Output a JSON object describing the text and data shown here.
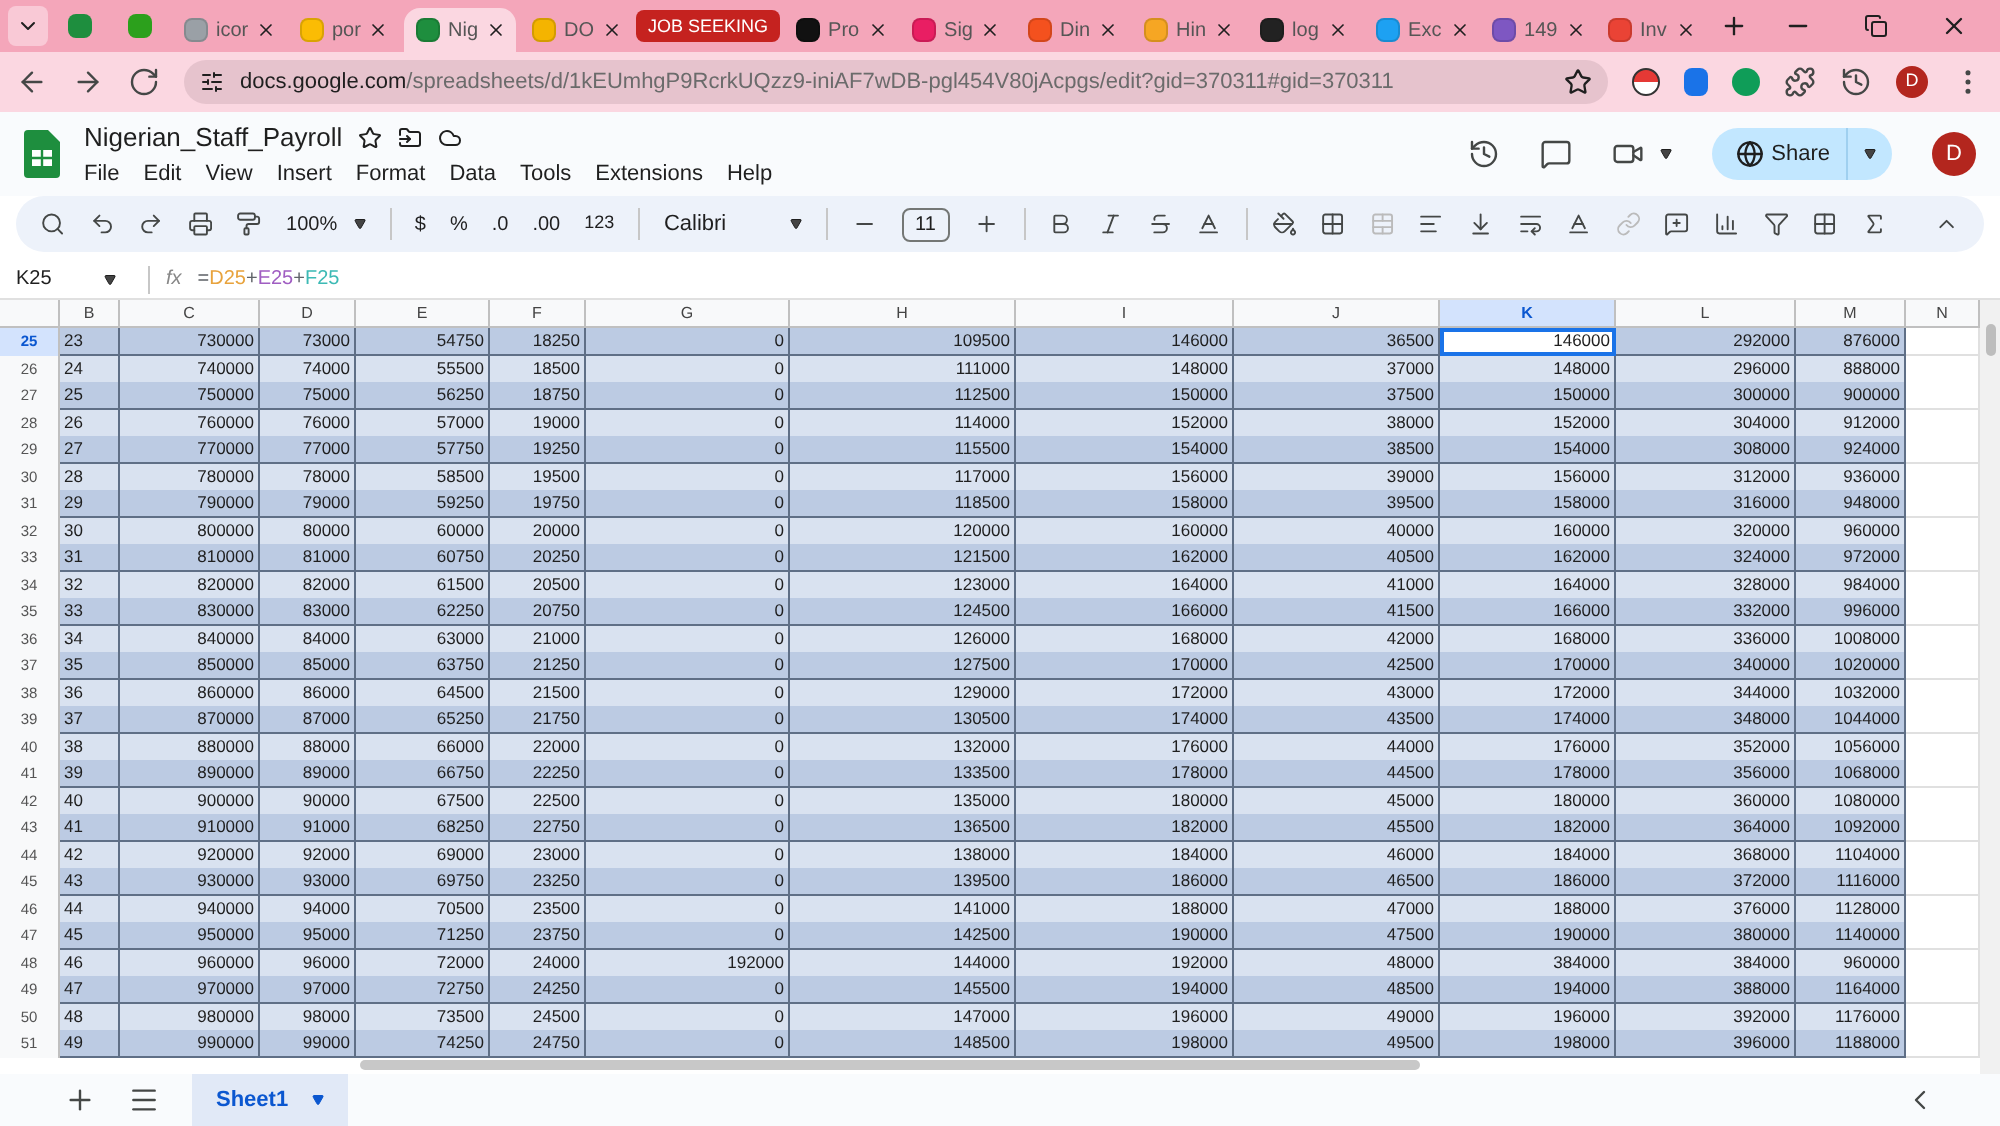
{
  "browser": {
    "tabs": [
      {
        "kind": "pinned",
        "selected": false
      },
      {
        "kind": "pinned",
        "selected": false
      },
      {
        "kind": "tab",
        "title": "icor",
        "selected": false
      },
      {
        "kind": "tab",
        "title": "por",
        "selected": false
      },
      {
        "kind": "tab",
        "title": "Nig",
        "selected": true
      },
      {
        "kind": "tab",
        "title": "DO",
        "selected": false
      },
      {
        "kind": "group",
        "title": "JOB SEEKING",
        "selected": false
      },
      {
        "kind": "tab",
        "title": "Pro",
        "selected": false
      },
      {
        "kind": "tab",
        "title": "Sig",
        "selected": false
      },
      {
        "kind": "tab",
        "title": "Din",
        "selected": false
      },
      {
        "kind": "tab",
        "title": "Hin",
        "selected": false
      },
      {
        "kind": "tab",
        "title": "log",
        "selected": false
      },
      {
        "kind": "tab",
        "title": "Exc",
        "selected": false
      },
      {
        "kind": "tab",
        "title": "149",
        "selected": false
      },
      {
        "kind": "tab",
        "title": "Inv",
        "selected": false
      }
    ],
    "url_host": "docs.google.com",
    "url_path": "/spreadsheets/d/1kEUmhgP9RcrkUQzz9-iniAF7wDB-pgl454V80jAcpgs/edit?gid=370311#gid=370311",
    "profile": "D"
  },
  "doc": {
    "title": "Nigerian_Staff_Payroll",
    "menu": [
      "File",
      "Edit",
      "View",
      "Insert",
      "Format",
      "Data",
      "Tools",
      "Extensions",
      "Help"
    ],
    "share": "Share",
    "avatar": "D"
  },
  "toolbar": {
    "zoom": "100%",
    "currency": "$",
    "percent": "%",
    "decrease_decimals": ".0",
    "increase_decimals": ".00",
    "number_format": "123",
    "font": "Calibri",
    "font_size": "11"
  },
  "formula_bar": {
    "cell": "K25",
    "fx": "fx",
    "formula": [
      {
        "kind": "operator",
        "text": "="
      },
      {
        "kind": "reference",
        "text": "D25",
        "color": "#e8a33d"
      },
      {
        "kind": "operator",
        "text": "+"
      },
      {
        "kind": "reference",
        "text": "E25",
        "color": "#a05ec2"
      },
      {
        "kind": "operator",
        "text": "+"
      },
      {
        "kind": "reference",
        "text": "F25",
        "color": "#3dbab5"
      }
    ]
  },
  "columns": [
    {
      "label": "B",
      "selected": false
    },
    {
      "label": "C",
      "selected": false
    },
    {
      "label": "D",
      "selected": false
    },
    {
      "label": "E",
      "selected": false
    },
    {
      "label": "F",
      "selected": false
    },
    {
      "label": "G",
      "selected": false
    },
    {
      "label": "H",
      "selected": false
    },
    {
      "label": "I",
      "selected": false
    },
    {
      "label": "J",
      "selected": false
    },
    {
      "label": "K",
      "selected": true
    },
    {
      "label": "L",
      "selected": false
    },
    {
      "label": "M",
      "selected": false
    },
    {
      "label": "N",
      "selected": false
    }
  ],
  "rows": [
    {
      "number": "25",
      "selected": true,
      "cells": [
        "23",
        "730000",
        "73000",
        "54750",
        "18250",
        "0",
        "109500",
        "146000",
        "36500",
        "146000",
        "292000",
        "876000"
      ]
    },
    {
      "number": "26",
      "selected": false,
      "cells": [
        "24",
        "740000",
        "74000",
        "55500",
        "18500",
        "0",
        "111000",
        "148000",
        "37000",
        "148000",
        "296000",
        "888000"
      ]
    },
    {
      "number": "27",
      "selected": false,
      "cells": [
        "25",
        "750000",
        "75000",
        "56250",
        "18750",
        "0",
        "112500",
        "150000",
        "37500",
        "150000",
        "300000",
        "900000"
      ]
    },
    {
      "number": "28",
      "selected": false,
      "cells": [
        "26",
        "760000",
        "76000",
        "57000",
        "19000",
        "0",
        "114000",
        "152000",
        "38000",
        "152000",
        "304000",
        "912000"
      ]
    },
    {
      "number": "29",
      "selected": false,
      "cells": [
        "27",
        "770000",
        "77000",
        "57750",
        "19250",
        "0",
        "115500",
        "154000",
        "38500",
        "154000",
        "308000",
        "924000"
      ]
    },
    {
      "number": "30",
      "selected": false,
      "cells": [
        "28",
        "780000",
        "78000",
        "58500",
        "19500",
        "0",
        "117000",
        "156000",
        "39000",
        "156000",
        "312000",
        "936000"
      ]
    },
    {
      "number": "31",
      "selected": false,
      "cells": [
        "29",
        "790000",
        "79000",
        "59250",
        "19750",
        "0",
        "118500",
        "158000",
        "39500",
        "158000",
        "316000",
        "948000"
      ]
    },
    {
      "number": "32",
      "selected": false,
      "cells": [
        "30",
        "800000",
        "80000",
        "60000",
        "20000",
        "0",
        "120000",
        "160000",
        "40000",
        "160000",
        "320000",
        "960000"
      ]
    },
    {
      "number": "33",
      "selected": false,
      "cells": [
        "31",
        "810000",
        "81000",
        "60750",
        "20250",
        "0",
        "121500",
        "162000",
        "40500",
        "162000",
        "324000",
        "972000"
      ]
    },
    {
      "number": "34",
      "selected": false,
      "cells": [
        "32",
        "820000",
        "82000",
        "61500",
        "20500",
        "0",
        "123000",
        "164000",
        "41000",
        "164000",
        "328000",
        "984000"
      ]
    },
    {
      "number": "35",
      "selected": false,
      "cells": [
        "33",
        "830000",
        "83000",
        "62250",
        "20750",
        "0",
        "124500",
        "166000",
        "41500",
        "166000",
        "332000",
        "996000"
      ]
    },
    {
      "number": "36",
      "selected": false,
      "cells": [
        "34",
        "840000",
        "84000",
        "63000",
        "21000",
        "0",
        "126000",
        "168000",
        "42000",
        "168000",
        "336000",
        "1008000"
      ]
    },
    {
      "number": "37",
      "selected": false,
      "cells": [
        "35",
        "850000",
        "85000",
        "63750",
        "21250",
        "0",
        "127500",
        "170000",
        "42500",
        "170000",
        "340000",
        "1020000"
      ]
    },
    {
      "number": "38",
      "selected": false,
      "cells": [
        "36",
        "860000",
        "86000",
        "64500",
        "21500",
        "0",
        "129000",
        "172000",
        "43000",
        "172000",
        "344000",
        "1032000"
      ]
    },
    {
      "number": "39",
      "selected": false,
      "cells": [
        "37",
        "870000",
        "87000",
        "65250",
        "21750",
        "0",
        "130500",
        "174000",
        "43500",
        "174000",
        "348000",
        "1044000"
      ]
    },
    {
      "number": "40",
      "selected": false,
      "cells": [
        "38",
        "880000",
        "88000",
        "66000",
        "22000",
        "0",
        "132000",
        "176000",
        "44000",
        "176000",
        "352000",
        "1056000"
      ]
    },
    {
      "number": "41",
      "selected": false,
      "cells": [
        "39",
        "890000",
        "89000",
        "66750",
        "22250",
        "0",
        "133500",
        "178000",
        "44500",
        "178000",
        "356000",
        "1068000"
      ]
    },
    {
      "number": "42",
      "selected": false,
      "cells": [
        "40",
        "900000",
        "90000",
        "67500",
        "22500",
        "0",
        "135000",
        "180000",
        "45000",
        "180000",
        "360000",
        "1080000"
      ]
    },
    {
      "number": "43",
      "selected": false,
      "cells": [
        "41",
        "910000",
        "91000",
        "68250",
        "22750",
        "0",
        "136500",
        "182000",
        "45500",
        "182000",
        "364000",
        "1092000"
      ]
    },
    {
      "number": "44",
      "selected": false,
      "cells": [
        "42",
        "920000",
        "92000",
        "69000",
        "23000",
        "0",
        "138000",
        "184000",
        "46000",
        "184000",
        "368000",
        "1104000"
      ]
    },
    {
      "number": "45",
      "selected": false,
      "cells": [
        "43",
        "930000",
        "93000",
        "69750",
        "23250",
        "0",
        "139500",
        "186000",
        "46500",
        "186000",
        "372000",
        "1116000"
      ]
    },
    {
      "number": "46",
      "selected": false,
      "cells": [
        "44",
        "940000",
        "94000",
        "70500",
        "23500",
        "0",
        "141000",
        "188000",
        "47000",
        "188000",
        "376000",
        "1128000"
      ]
    },
    {
      "number": "47",
      "selected": false,
      "cells": [
        "45",
        "950000",
        "95000",
        "71250",
        "23750",
        "0",
        "142500",
        "190000",
        "47500",
        "190000",
        "380000",
        "1140000"
      ]
    },
    {
      "number": "48",
      "selected": false,
      "cells": [
        "46",
        "960000",
        "96000",
        "72000",
        "24000",
        "192000",
        "144000",
        "192000",
        "48000",
        "384000",
        "384000",
        "960000"
      ]
    },
    {
      "number": "49",
      "selected": false,
      "cells": [
        "47",
        "970000",
        "97000",
        "72750",
        "24250",
        "0",
        "145500",
        "194000",
        "48500",
        "194000",
        "388000",
        "1164000"
      ]
    },
    {
      "number": "50",
      "selected": false,
      "cells": [
        "48",
        "980000",
        "98000",
        "73500",
        "24500",
        "0",
        "147000",
        "196000",
        "49000",
        "196000",
        "392000",
        "1176000"
      ]
    },
    {
      "number": "51",
      "selected": false,
      "cells": [
        "49",
        "990000",
        "99000",
        "74250",
        "24750",
        "0",
        "148500",
        "198000",
        "49500",
        "198000",
        "396000",
        "1188000"
      ]
    }
  ],
  "sheets": [
    {
      "name": "Sheet1",
      "selected": true
    }
  ]
}
